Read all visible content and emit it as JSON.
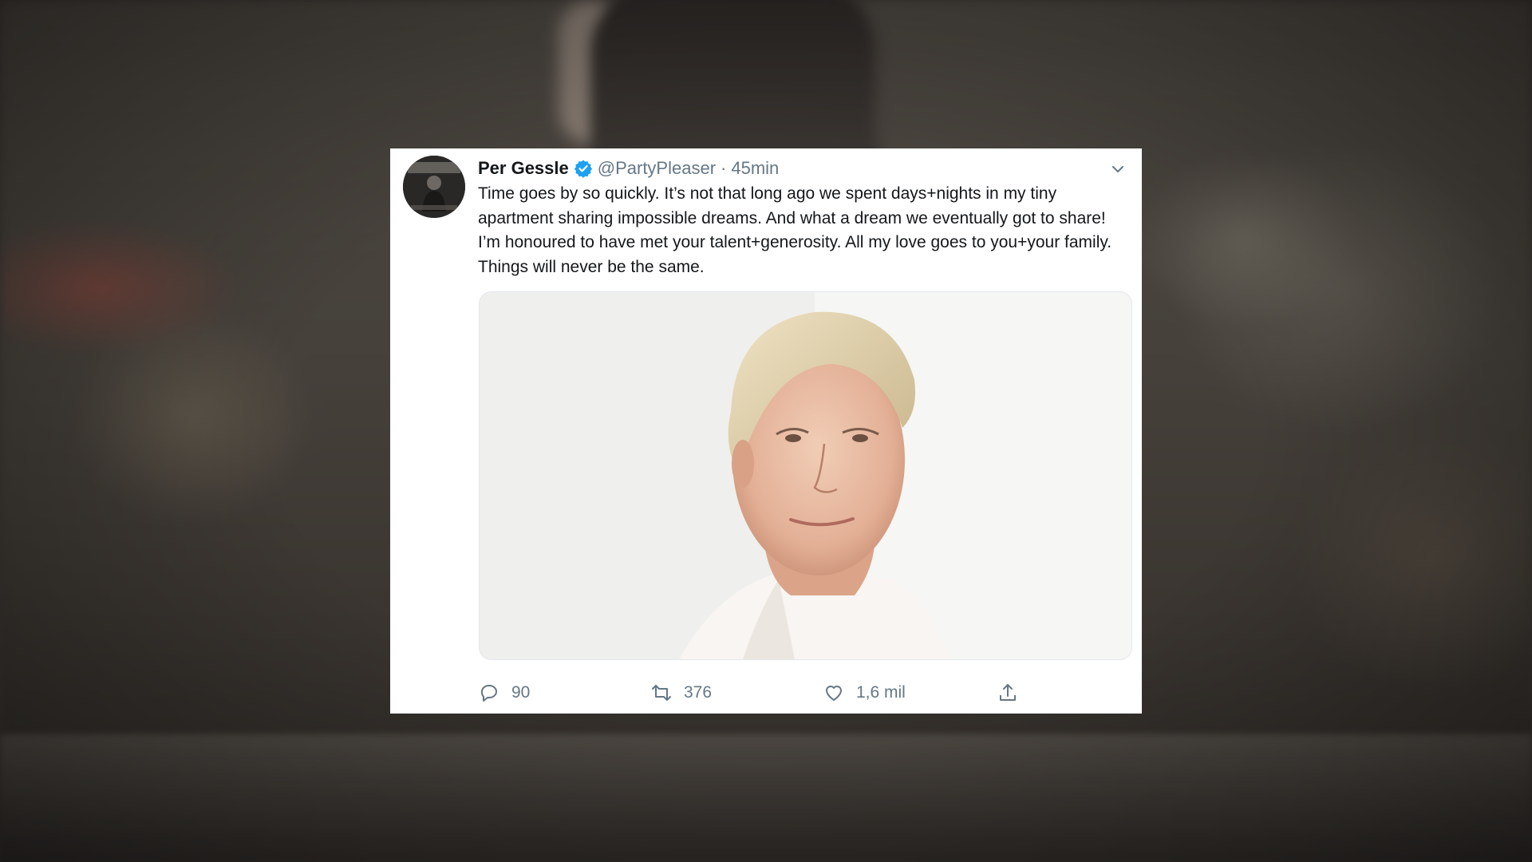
{
  "tweet": {
    "author_name": "Per Gessle",
    "handle": "@PartyPleaser",
    "separator": "·",
    "time": "45min",
    "text": "Time goes by so quickly. It’s not that long ago we spent days+nights in my tiny apartment sharing impossible dreams. And what a dream we eventually got to share! I’m honoured to have met your talent+generosity. All my love goes to you+your family. Things will never be the same.",
    "verified_icon": "verified-badge-icon",
    "caret_icon": "chevron-down-icon",
    "accent_color": "#1da1f2"
  },
  "actions": {
    "reply_count": "90",
    "retweet_count": "376",
    "like_count": "1,6 mil"
  },
  "icons": {
    "reply": "reply-bubble-icon",
    "retweet": "retweet-icon",
    "like": "heart-icon",
    "share": "share-upload-icon"
  }
}
